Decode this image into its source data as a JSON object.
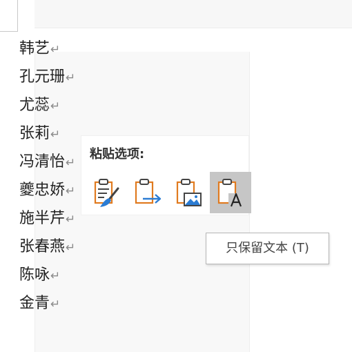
{
  "document": {
    "lines": [
      {
        "text": "韩艺"
      },
      {
        "text": "孔元珊"
      },
      {
        "text": "尤蕊"
      },
      {
        "text": "张莉"
      },
      {
        "text": "冯清怡"
      },
      {
        "text": "夔忠娇"
      },
      {
        "text": "施半芹"
      },
      {
        "text": "张春燕"
      },
      {
        "text": "陈咏"
      },
      {
        "text": "金青"
      }
    ],
    "paragraph_mark": "↵"
  },
  "paste_options": {
    "title": "粘贴选项:",
    "buttons": [
      {
        "icon": "keep-source-formatting-icon"
      },
      {
        "icon": "merge-formatting-icon"
      },
      {
        "icon": "picture-icon"
      },
      {
        "icon": "keep-text-only-icon",
        "selected": true
      }
    ]
  },
  "tooltip": {
    "text": "只保留文本 (T)"
  },
  "colors": {
    "clipboard_orange": "#e07a1f",
    "accent_blue": "#2b7cd3",
    "selected_bg": "#c6c6c6"
  }
}
